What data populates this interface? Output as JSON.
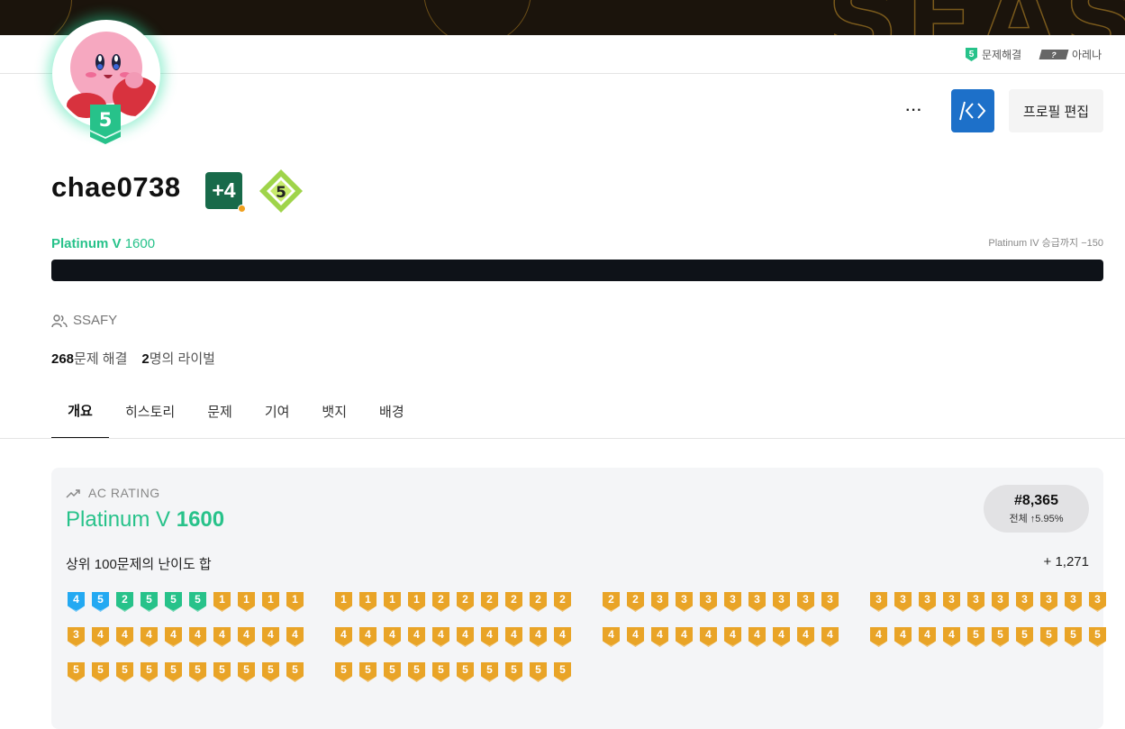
{
  "banner": {
    "text": "SEAS"
  },
  "topbar": {
    "solved_label": "문제해결",
    "solved_tier": "5",
    "arena_label": "아레나",
    "arena_badge": "?"
  },
  "profile": {
    "avatar_badge": "5",
    "more_label": "···",
    "code_icon": "/<>",
    "edit_label": "프로필 편집",
    "username": "chae0738",
    "plus_badge": "+4",
    "class_badge": "5",
    "rating_tier": "Platinum V",
    "rating_value": "1600",
    "next_tier": "Platinum IV 승급까지 −150",
    "progress": 1.0,
    "organization": "SSAFY",
    "solved_count": "268",
    "solved_label": "문제 해결",
    "rival_count": "2",
    "rival_label": "명의 라이벌"
  },
  "tabs": [
    "개요",
    "히스토리",
    "문제",
    "기여",
    "뱃지",
    "배경"
  ],
  "ac_rating": {
    "label": "AC RATING",
    "tier": "Platinum V",
    "value": "1600",
    "rank": "#8,365",
    "rank_sub": "전체 ↑5.95%",
    "top100_label": "상위 100문제의 난이도 합",
    "top100_sum": "+ 1,271"
  },
  "tier_rows": [
    [
      [
        [
          "dia",
          "4"
        ],
        [
          "dia",
          "5"
        ],
        [
          "plat",
          "2"
        ],
        [
          "plat",
          "5"
        ],
        [
          "plat",
          "5"
        ],
        [
          "plat",
          "5"
        ],
        [
          "gold",
          "1"
        ],
        [
          "gold",
          "1"
        ],
        [
          "gold",
          "1"
        ],
        [
          "gold",
          "1"
        ]
      ],
      [
        [
          "gold",
          "1"
        ],
        [
          "gold",
          "1"
        ],
        [
          "gold",
          "1"
        ],
        [
          "gold",
          "1"
        ],
        [
          "gold",
          "2"
        ],
        [
          "gold",
          "2"
        ],
        [
          "gold",
          "2"
        ],
        [
          "gold",
          "2"
        ],
        [
          "gold",
          "2"
        ],
        [
          "gold",
          "2"
        ]
      ],
      [
        [
          "gold",
          "2"
        ],
        [
          "gold",
          "2"
        ],
        [
          "gold",
          "3"
        ],
        [
          "gold",
          "3"
        ],
        [
          "gold",
          "3"
        ],
        [
          "gold",
          "3"
        ],
        [
          "gold",
          "3"
        ],
        [
          "gold",
          "3"
        ],
        [
          "gold",
          "3"
        ],
        [
          "gold",
          "3"
        ]
      ],
      [
        [
          "gold",
          "3"
        ],
        [
          "gold",
          "3"
        ],
        [
          "gold",
          "3"
        ],
        [
          "gold",
          "3"
        ],
        [
          "gold",
          "3"
        ],
        [
          "gold",
          "3"
        ],
        [
          "gold",
          "3"
        ],
        [
          "gold",
          "3"
        ],
        [
          "gold",
          "3"
        ],
        [
          "gold",
          "3"
        ]
      ]
    ],
    [
      [
        [
          "gold",
          "3"
        ],
        [
          "gold",
          "4"
        ],
        [
          "gold",
          "4"
        ],
        [
          "gold",
          "4"
        ],
        [
          "gold",
          "4"
        ],
        [
          "gold",
          "4"
        ],
        [
          "gold",
          "4"
        ],
        [
          "gold",
          "4"
        ],
        [
          "gold",
          "4"
        ],
        [
          "gold",
          "4"
        ]
      ],
      [
        [
          "gold",
          "4"
        ],
        [
          "gold",
          "4"
        ],
        [
          "gold",
          "4"
        ],
        [
          "gold",
          "4"
        ],
        [
          "gold",
          "4"
        ],
        [
          "gold",
          "4"
        ],
        [
          "gold",
          "4"
        ],
        [
          "gold",
          "4"
        ],
        [
          "gold",
          "4"
        ],
        [
          "gold",
          "4"
        ]
      ],
      [
        [
          "gold",
          "4"
        ],
        [
          "gold",
          "4"
        ],
        [
          "gold",
          "4"
        ],
        [
          "gold",
          "4"
        ],
        [
          "gold",
          "4"
        ],
        [
          "gold",
          "4"
        ],
        [
          "gold",
          "4"
        ],
        [
          "gold",
          "4"
        ],
        [
          "gold",
          "4"
        ],
        [
          "gold",
          "4"
        ]
      ],
      [
        [
          "gold",
          "4"
        ],
        [
          "gold",
          "4"
        ],
        [
          "gold",
          "4"
        ],
        [
          "gold",
          "4"
        ],
        [
          "gold",
          "5"
        ],
        [
          "gold",
          "5"
        ],
        [
          "gold",
          "5"
        ],
        [
          "gold",
          "5"
        ],
        [
          "gold",
          "5"
        ],
        [
          "gold",
          "5"
        ]
      ]
    ],
    [
      [
        [
          "gold",
          "5"
        ],
        [
          "gold",
          "5"
        ],
        [
          "gold",
          "5"
        ],
        [
          "gold",
          "5"
        ],
        [
          "gold",
          "5"
        ],
        [
          "gold",
          "5"
        ],
        [
          "gold",
          "5"
        ],
        [
          "gold",
          "5"
        ],
        [
          "gold",
          "5"
        ],
        [
          "gold",
          "5"
        ]
      ],
      [
        [
          "gold",
          "5"
        ],
        [
          "gold",
          "5"
        ],
        [
          "gold",
          "5"
        ],
        [
          "gold",
          "5"
        ],
        [
          "gold",
          "5"
        ],
        [
          "gold",
          "5"
        ],
        [
          "gold",
          "5"
        ],
        [
          "gold",
          "5"
        ],
        [
          "gold",
          "5"
        ],
        [
          "gold",
          "5"
        ]
      ]
    ]
  ],
  "colors": {
    "platinum": "#27c28a",
    "diamond": "#23a9f2",
    "gold": "#e9a427",
    "accent": "#1d70c9"
  }
}
